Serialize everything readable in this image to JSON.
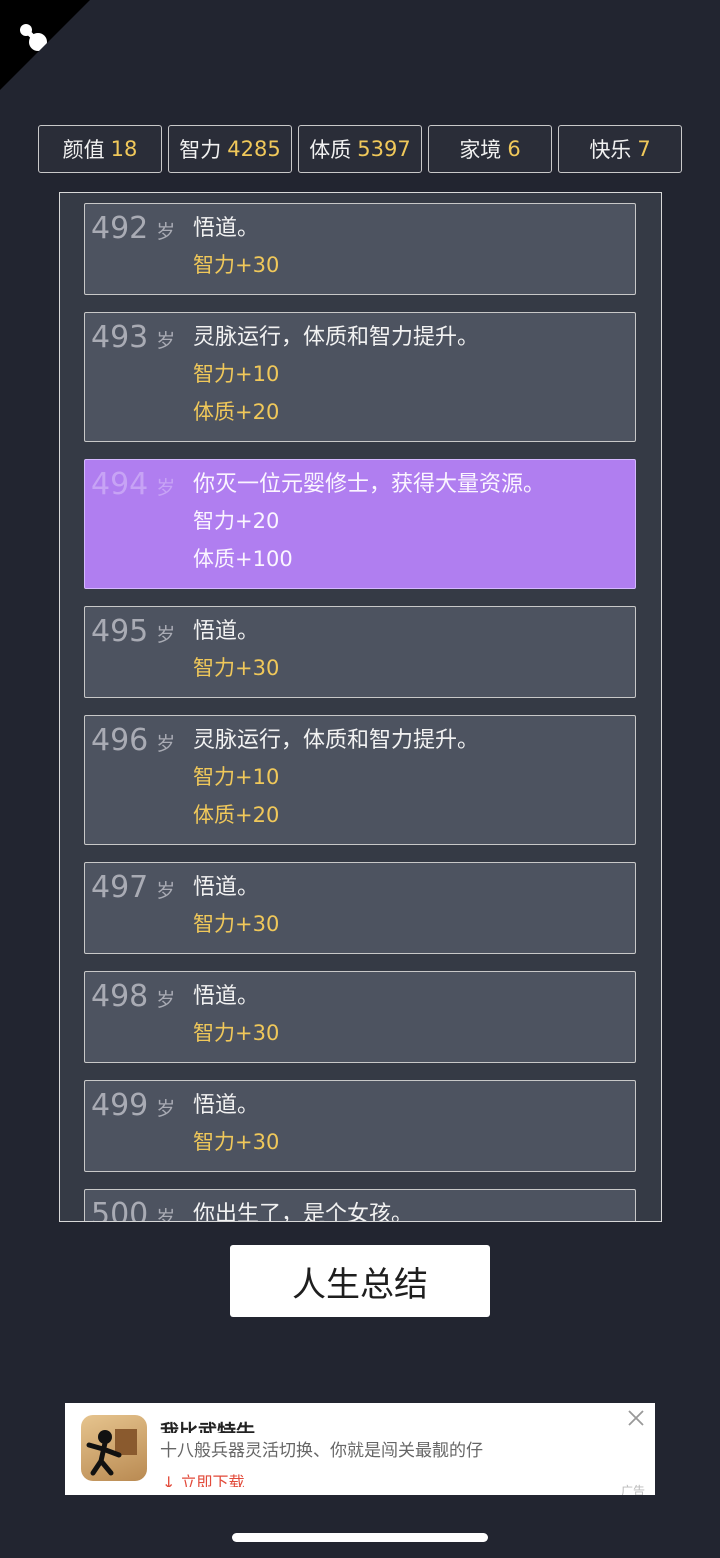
{
  "stats": [
    {
      "label": "颜值",
      "value": "18"
    },
    {
      "label": "智力",
      "value": "4285"
    },
    {
      "label": "体质",
      "value": "5397"
    },
    {
      "label": "家境",
      "value": "6"
    },
    {
      "label": "快乐",
      "value": "7"
    }
  ],
  "entries": [
    {
      "age": "492",
      "unit": "岁",
      "event": "悟道。",
      "effects": [
        "智力+30"
      ]
    },
    {
      "age": "493",
      "unit": "岁",
      "event": "灵脉运行，体质和智力提升。",
      "effects": [
        "智力+10",
        "体质+20"
      ]
    },
    {
      "age": "494",
      "unit": "岁",
      "event": "你灭一位元婴修士，获得大量资源。",
      "effects": [
        "智力+20",
        "体质+100"
      ]
    },
    {
      "age": "495",
      "unit": "岁",
      "event": "悟道。",
      "effects": [
        "智力+30"
      ]
    },
    {
      "age": "496",
      "unit": "岁",
      "event": "灵脉运行，体质和智力提升。",
      "effects": [
        "智力+10",
        "体质+20"
      ]
    },
    {
      "age": "497",
      "unit": "岁",
      "event": "悟道。",
      "effects": [
        "智力+30"
      ]
    },
    {
      "age": "498",
      "unit": "岁",
      "event": "悟道。",
      "effects": [
        "智力+30"
      ]
    },
    {
      "age": "499",
      "unit": "岁",
      "event": "悟道。",
      "effects": [
        "智力+30"
      ]
    },
    {
      "age": "500",
      "unit": "岁",
      "event": "你出生了，是个女孩。",
      "effects": []
    }
  ],
  "summary_button": "人生总结",
  "ad": {
    "title": "我比武特牛",
    "description": "十八般兵器灵活切换、你就是闯关最靓的仔",
    "cta": "立即下载",
    "tag": "广告"
  },
  "colors": {
    "background": "#222530",
    "stat_value": "#f0c85a",
    "highlight": "#b07ef0"
  }
}
